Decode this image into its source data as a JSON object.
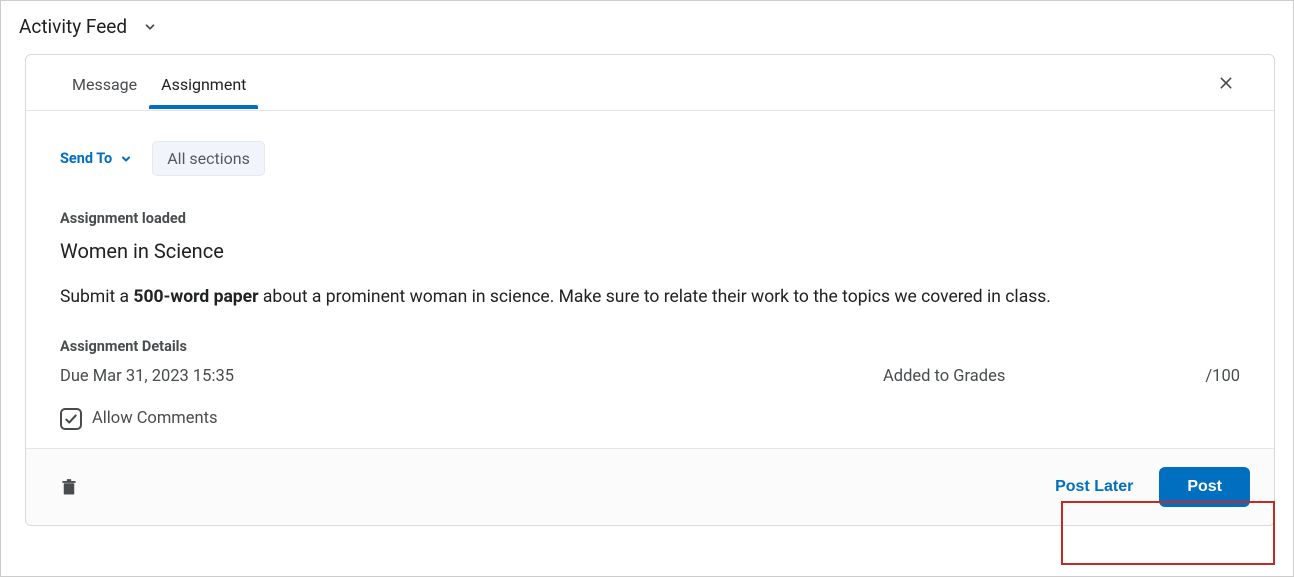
{
  "header": {
    "title": "Activity Feed"
  },
  "tabs": {
    "message": "Message",
    "assignment": "Assignment"
  },
  "sendto": {
    "label": "Send To",
    "chip": "All sections"
  },
  "assignment": {
    "loaded_label": "Assignment loaded",
    "title": "Women in Science",
    "desc_prefix": "Submit a ",
    "desc_bold": "500-word paper",
    "desc_suffix": " about a prominent woman in science. Make sure to relate their work to the topics we covered in class.",
    "details_label": "Assignment Details",
    "due": "Due Mar 31, 2023 15:35",
    "added": "Added to Grades",
    "outof": "/100",
    "allow_comments": "Allow Comments"
  },
  "footer": {
    "post_later": "Post Later",
    "post": "Post"
  }
}
